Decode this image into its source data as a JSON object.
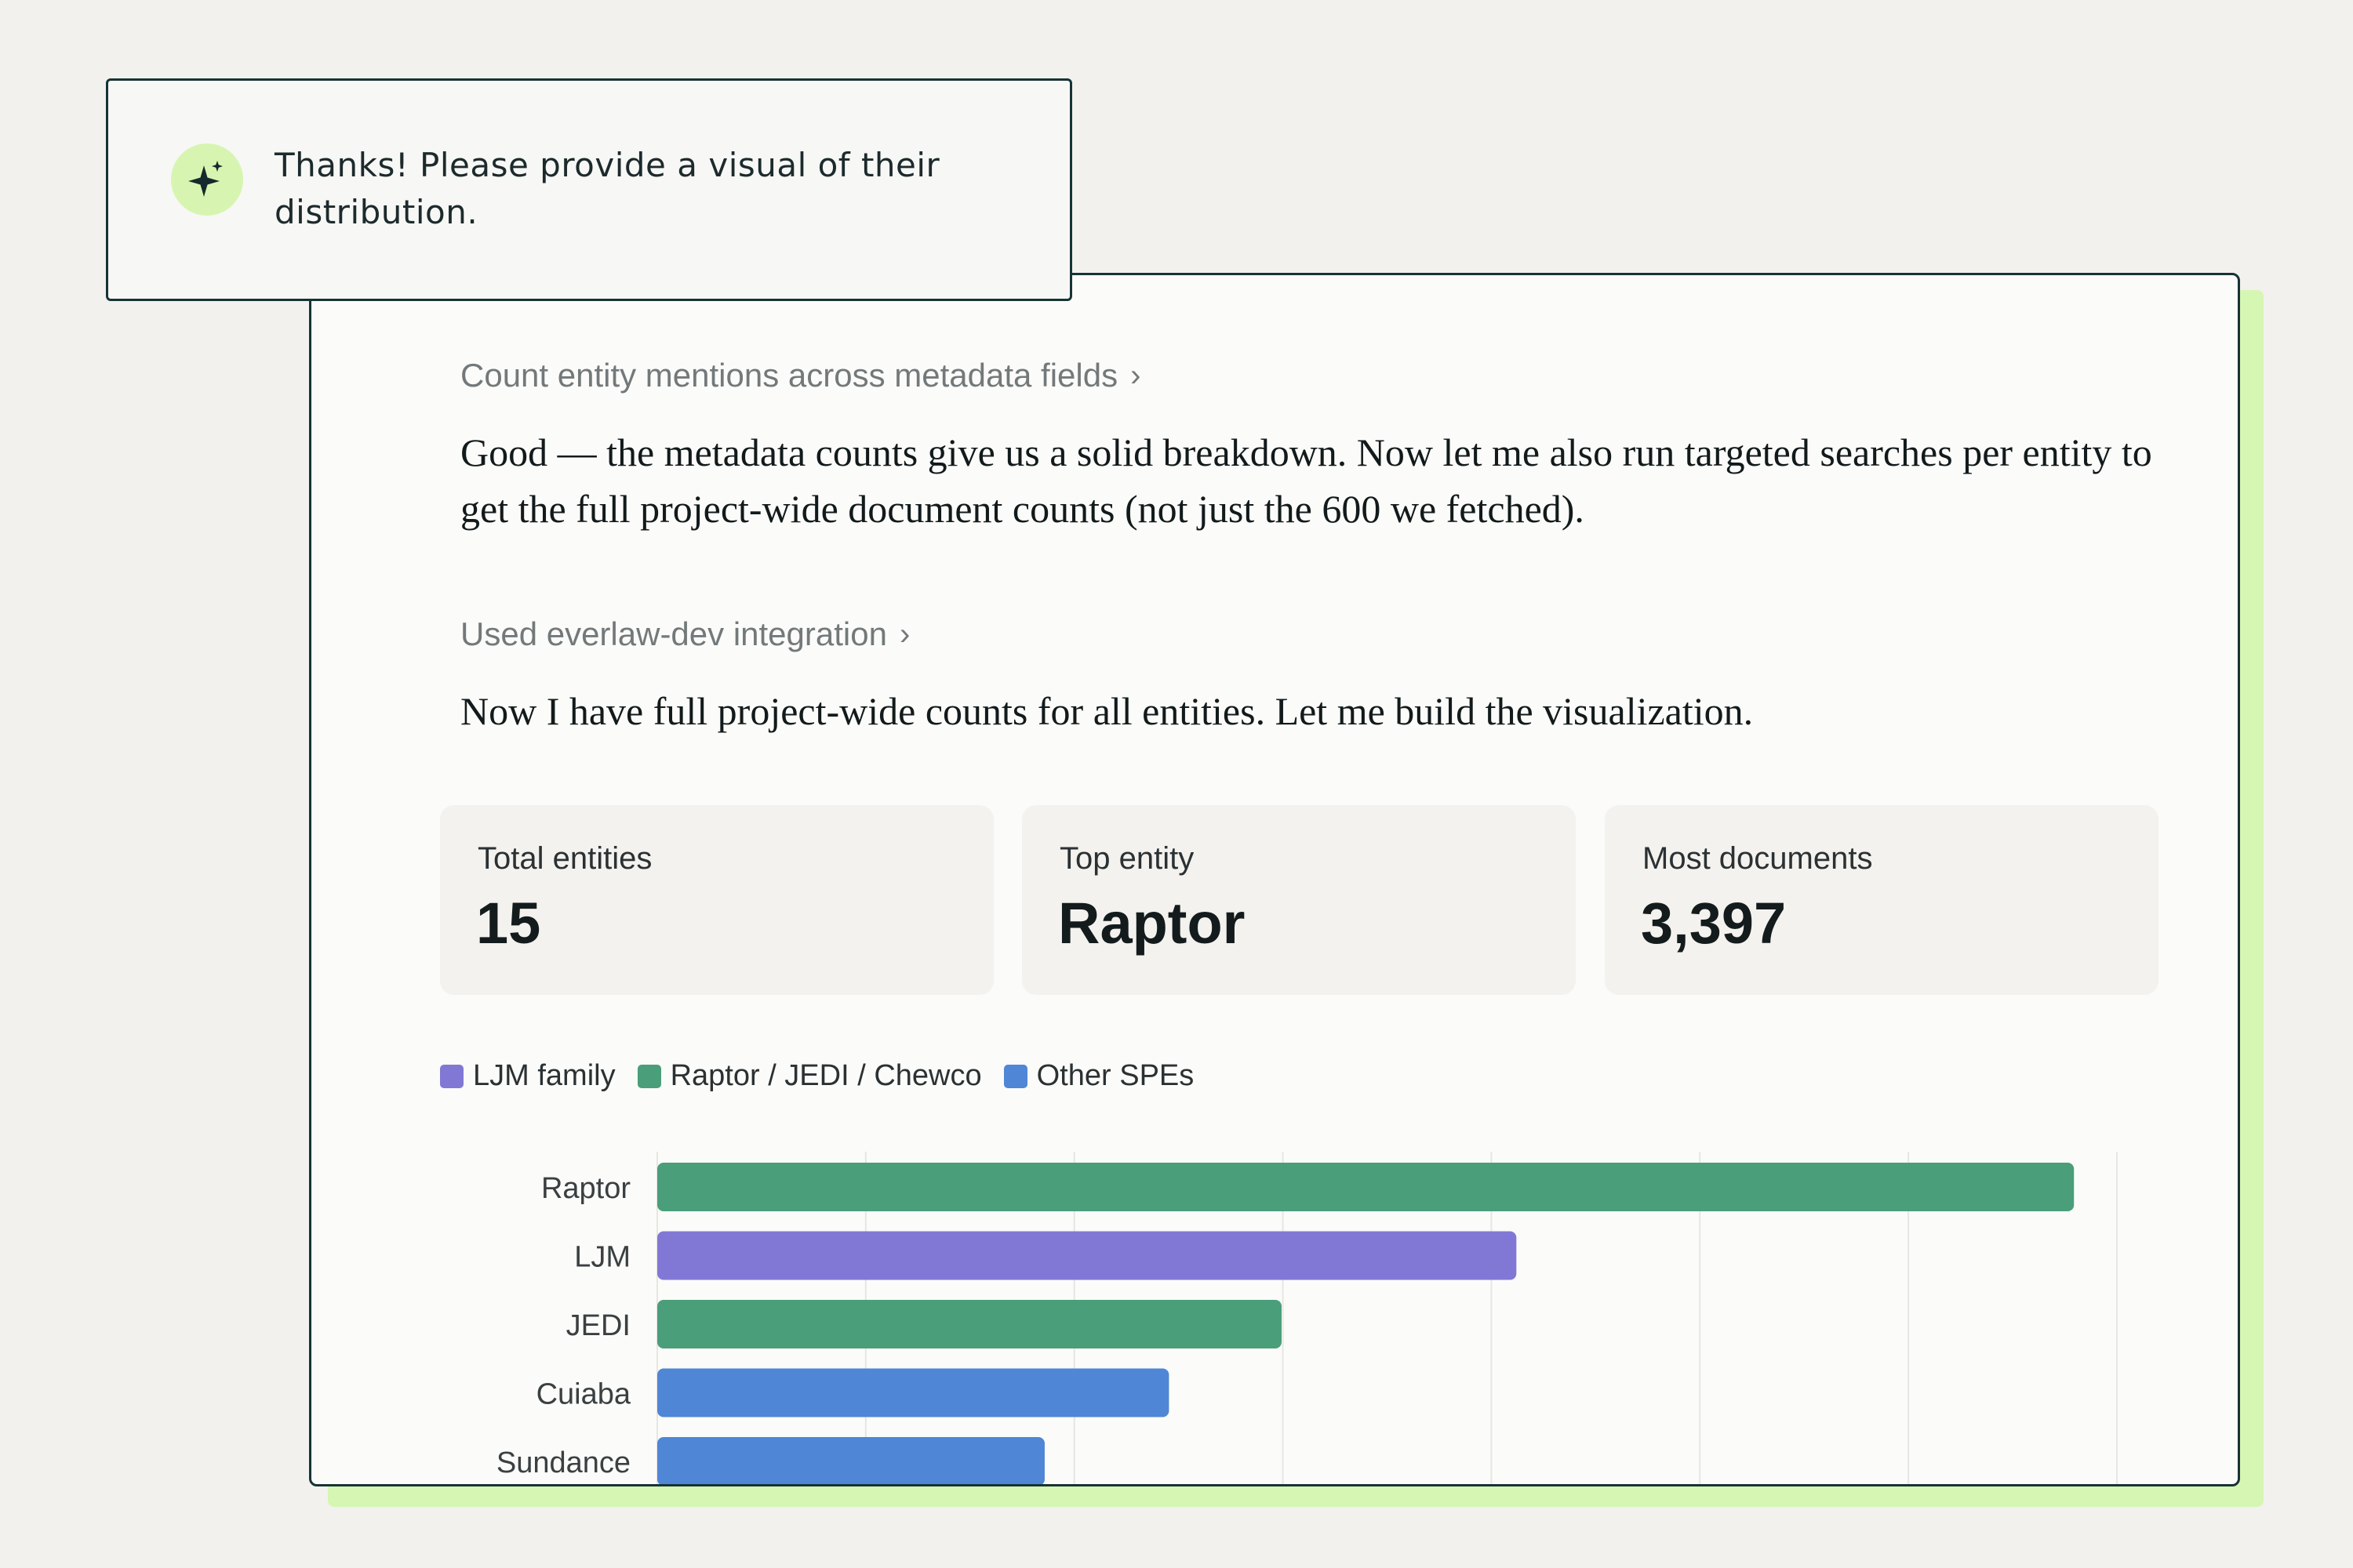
{
  "prompt": {
    "text": "Thanks! Please provide a visual of their distribution."
  },
  "steps": [
    {
      "label": "Count entity mentions across metadata fields",
      "chevron": "›"
    },
    {
      "label": "Used everlaw-dev integration",
      "chevron": "›"
    }
  ],
  "paragraphs": [
    "Good — the metadata counts give us a solid breakdown. Now let me also run targeted searches per entity to get the full project-wide document counts (not just the 600 we fetched).",
    "Now I have full project-wide counts for all entities. Let me build the visualization."
  ],
  "stats": [
    {
      "label": "Total entities",
      "value": "15"
    },
    {
      "label": "Top entity",
      "value": "Raptor"
    },
    {
      "label": "Most documents",
      "value": "3,397"
    }
  ],
  "legend": [
    {
      "label": "LJM family",
      "color": "#8178d6"
    },
    {
      "label": "Raptor / JEDI / Chewco",
      "color": "#4a9e7a"
    },
    {
      "label": "Other SPEs",
      "color": "#4f86d6"
    }
  ],
  "icons": {
    "ai_badge": "sparkle-icon",
    "step_chevron": "chevron-right-icon"
  },
  "chart_data": {
    "type": "bar",
    "orientation": "horizontal",
    "categories": [
      "Raptor",
      "LJM",
      "JEDI",
      "Cuiaba",
      "Sundance"
    ],
    "values": [
      3397,
      2060,
      1497,
      1227,
      929
    ],
    "groups": [
      "Raptor / JEDI / Chewco",
      "LJM family",
      "Raptor / JEDI / Chewco",
      "Other SPEs",
      "Other SPEs"
    ],
    "colors": [
      "#4a9e7a",
      "#8178d6",
      "#4a9e7a",
      "#4f86d6",
      "#4f86d6"
    ],
    "xlim": [
      0,
      3500
    ],
    "grid": true,
    "legend_placement": "top-left"
  }
}
